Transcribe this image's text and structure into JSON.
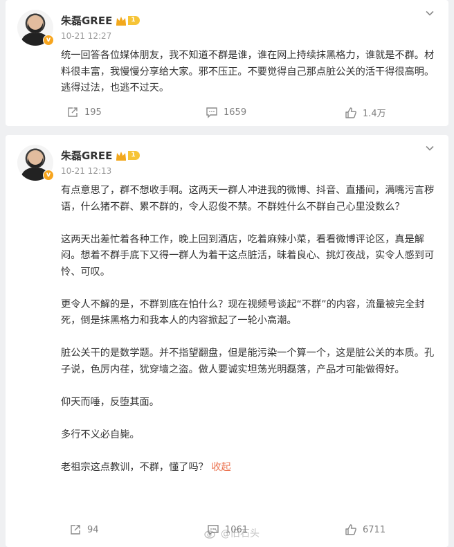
{
  "posts": [
    {
      "author": "朱磊GREE",
      "level": "1",
      "time": "10-21 12:27",
      "paragraphs": [
        "统一回答各位媒体朋友，我不知道不群是谁，谁在网上持续抹黑格力，谁就是不群。材料很丰富，我慢慢分享给大家。邪不压正。不要觉得自己那点脏公关的活干得很高明。逃得过法，也逃不过天。"
      ],
      "reposts": "195",
      "comments": "1659",
      "likes": "1.4万",
      "icons": {
        "repost": "share-icon",
        "comment": "comment-icon",
        "like": "thumbs-up-icon",
        "more": "chevron-down-icon"
      }
    },
    {
      "author": "朱磊GREE",
      "level": "1",
      "time": "10-21 12:13",
      "paragraphs": [
        "有点意思了，群不想收手啊。这两天一群人冲进我的微博、抖音、直播间，满嘴污言秽语，什么猪不群、累不群的，令人忍俊不禁。不群姓什么不群自己心里没数么？",
        "这两天出差忙着各种工作，晚上回到酒店，吃着麻辣小菜，看看微博评论区，真是解闷。想着不群手底下又得一群人为着干这点脏活，昧着良心、挑灯夜战，实令人感到可怜、可叹。",
        "更令人不解的是，不群到底在怕什么？现在视频号谈起“不群”的内容，流量被完全封死，倒是抹黑格力和我本人的内容掀起了一轮小高潮。",
        "脏公关干的是数学题。并不指望翻盘，但是能污染一个算一个，这是脏公关的本质。孔子说，色厉内荏，犹穿墙之盗。做人要诚实坦荡光明磊落，产品才可能做得好。",
        "仰天而唾，反堕其面。",
        "多行不义必自毙。",
        "老祖宗这点教训，不群，懂了吗？"
      ],
      "collapse_label": "收起",
      "reposts": "94",
      "comments": "1061",
      "likes": "6711"
    }
  ],
  "watermark": "@旧石头",
  "colors": {
    "background": "#eff0f2",
    "card": "#ffffff",
    "link": "#eb7350",
    "verified": "#f7a51e",
    "muted": "#808080"
  }
}
